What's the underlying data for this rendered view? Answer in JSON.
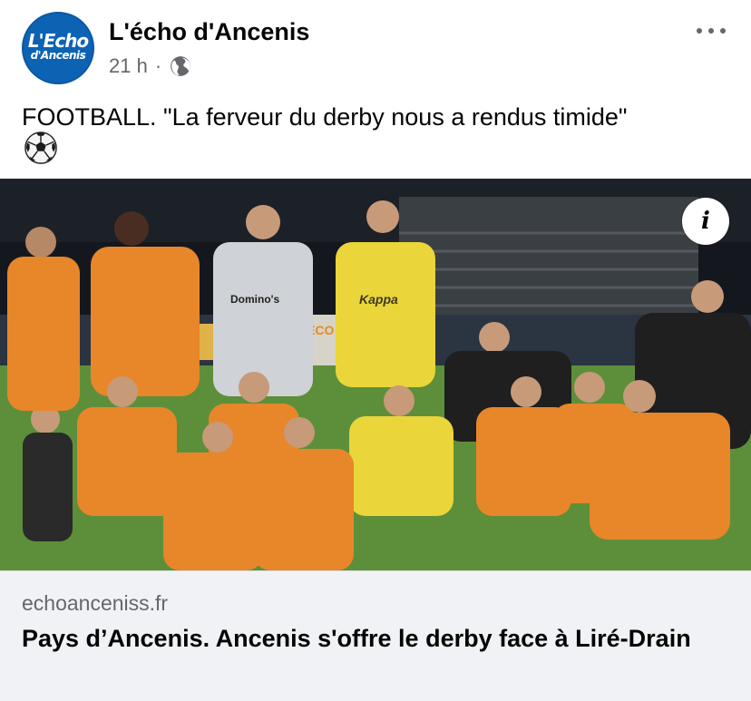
{
  "header": {
    "avatar_top": "L'Echo",
    "avatar_bottom": "d'Ancenis",
    "page_name": "L'écho d'Ancenis",
    "time": "21 h",
    "separator": "·",
    "audience_icon": "globe-icon",
    "more_icon": "more-options-icon"
  },
  "post": {
    "text": "FOOTBALL. \"La ferveur du derby nous a rendus timide\"",
    "emoji_icon": "soccer-ball-icon"
  },
  "photo": {
    "info_icon": "info-icon",
    "info_label": "i",
    "shirt_sponsor": "Domino's",
    "bib_brand": "Kappa",
    "board_text": "ECO"
  },
  "link": {
    "domain": "echoanceniss.fr",
    "title": "Pays d’Ancenis. Ancenis s'offre le derby face à Liré-Drain"
  },
  "colors": {
    "brand_blue": "#0c63b4",
    "jersey_orange": "#e8862a",
    "bib_yellow": "#ead53a",
    "pitch_green": "#5d8f3a",
    "card_bg": "#f0f2f5",
    "meta_gray": "#65676b"
  }
}
